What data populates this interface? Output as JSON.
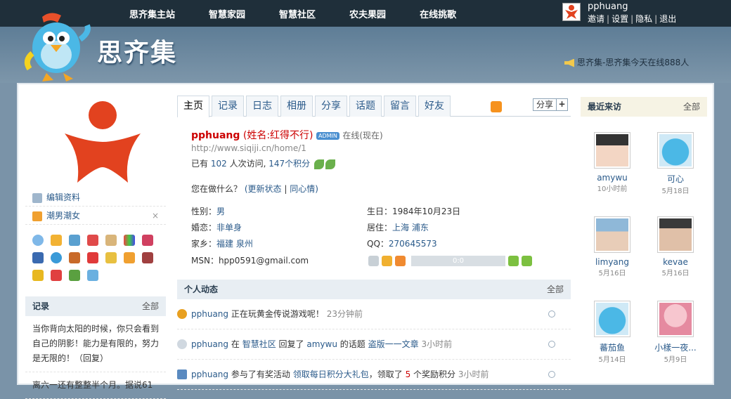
{
  "nav": [
    "思齐集主站",
    "智慧家园",
    "智慧社区",
    "农夫果园",
    "在线挑歌"
  ],
  "user": {
    "name": "pphuang",
    "links": [
      "邀请",
      "设置",
      "隐私",
      "退出"
    ]
  },
  "notice": "思齐集-思齐集今天在线888人",
  "logo_text": "思齐集",
  "left": {
    "menu": [
      "编辑资料",
      "潮男潮女"
    ],
    "records_title": "记录",
    "records_more": "全部",
    "records": [
      "当你背向太阳的时候，你只会看到自己的阴影！能力是有限的，努力是无限的！（回复）",
      "离六一还有整整半个月。据说61"
    ]
  },
  "tabs": [
    "主页",
    "记录",
    "日志",
    "相册",
    "分享",
    "话题",
    "留言",
    "好友"
  ],
  "share_label": "分享",
  "profile": {
    "name": "pphuang",
    "realname": "(姓名:红得不行)",
    "badge": "ADMIN",
    "online": "在线(现在)",
    "url": "http://www.siqiji.cn/home/1",
    "visits_pre": "已有",
    "visits_num": "102",
    "visits_mid": "人次访问,",
    "points": "147个积分",
    "doing": "您在做什么？",
    "update": "(更新状态",
    "sep": "|",
    "mood": "同心情)"
  },
  "info": {
    "gender_l": "性别：",
    "gender": "男",
    "marriage_l": "婚恋：",
    "marriage": "非单身",
    "home_l": "家乡：",
    "home": "福建  泉州",
    "msn_l": "MSN：",
    "msn": "hpp0591@gmail.com",
    "birth_l": "生日：",
    "birth": "1984年10月23日",
    "live_l": "居住：",
    "live": "上海  浦东",
    "qq_l": "QQ：",
    "qq": "270645573"
  },
  "player_time": "0:0",
  "feed_title": "个人动态",
  "feed_more": "全部",
  "feed": [
    {
      "user": "pphuang",
      "text": "正在玩黄金传说游戏呢！",
      "time": "23分钟前"
    },
    {
      "user": "pphuang",
      "text": "在",
      "place": "智慧社区",
      "text2": "回复了",
      "target": "amywu",
      "text3": "的话题",
      "topic": "盗版一一文章",
      "time": "3小时前"
    },
    {
      "user": "pphuang",
      "text": "参与了有奖活动",
      "event": "领取每日积分大礼包",
      "text2": "，领取了",
      "num": "5",
      "text3": "个奖励积分",
      "time": "3小时前"
    }
  ],
  "visitors_title": "最近来访",
  "visitors_more": "全部",
  "visitors": [
    {
      "name": "amywu",
      "time": "10小时前"
    },
    {
      "name": "可心",
      "time": "5月18日"
    },
    {
      "name": "limyang",
      "time": "5月16日"
    },
    {
      "name": "kevae",
      "time": "5月16日"
    },
    {
      "name": "蕃茄鱼",
      "time": "5月14日"
    },
    {
      "name": "小樣一夜...",
      "time": "5月9日"
    }
  ]
}
